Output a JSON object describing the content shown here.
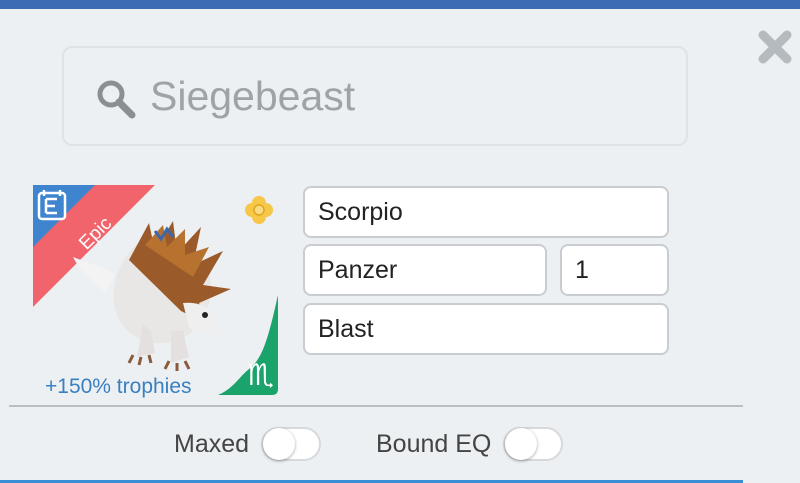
{
  "colors": {
    "top_bar": "#3d6bb4",
    "epic_ribbon": "#f2646b",
    "element_badge": "#1aa36b",
    "trophy_text": "#3a7fc1",
    "tab_underline": "#3a8fd4"
  },
  "icons": {
    "close": "close-icon",
    "search": "search-icon",
    "card_type": "card-e-icon",
    "element": "scorpio-icon",
    "gold_flower": "gold-flower-icon"
  },
  "search": {
    "value": "Siegebeast"
  },
  "card": {
    "rarity": "Epic",
    "trophies_text": "+150% trophies"
  },
  "form": {
    "name": "Scorpio",
    "type": "Panzer",
    "level": "1",
    "skill": "Blast"
  },
  "toggles": [
    {
      "label": "Maxed",
      "on": false
    },
    {
      "label": "Bound EQ",
      "on": false
    }
  ]
}
